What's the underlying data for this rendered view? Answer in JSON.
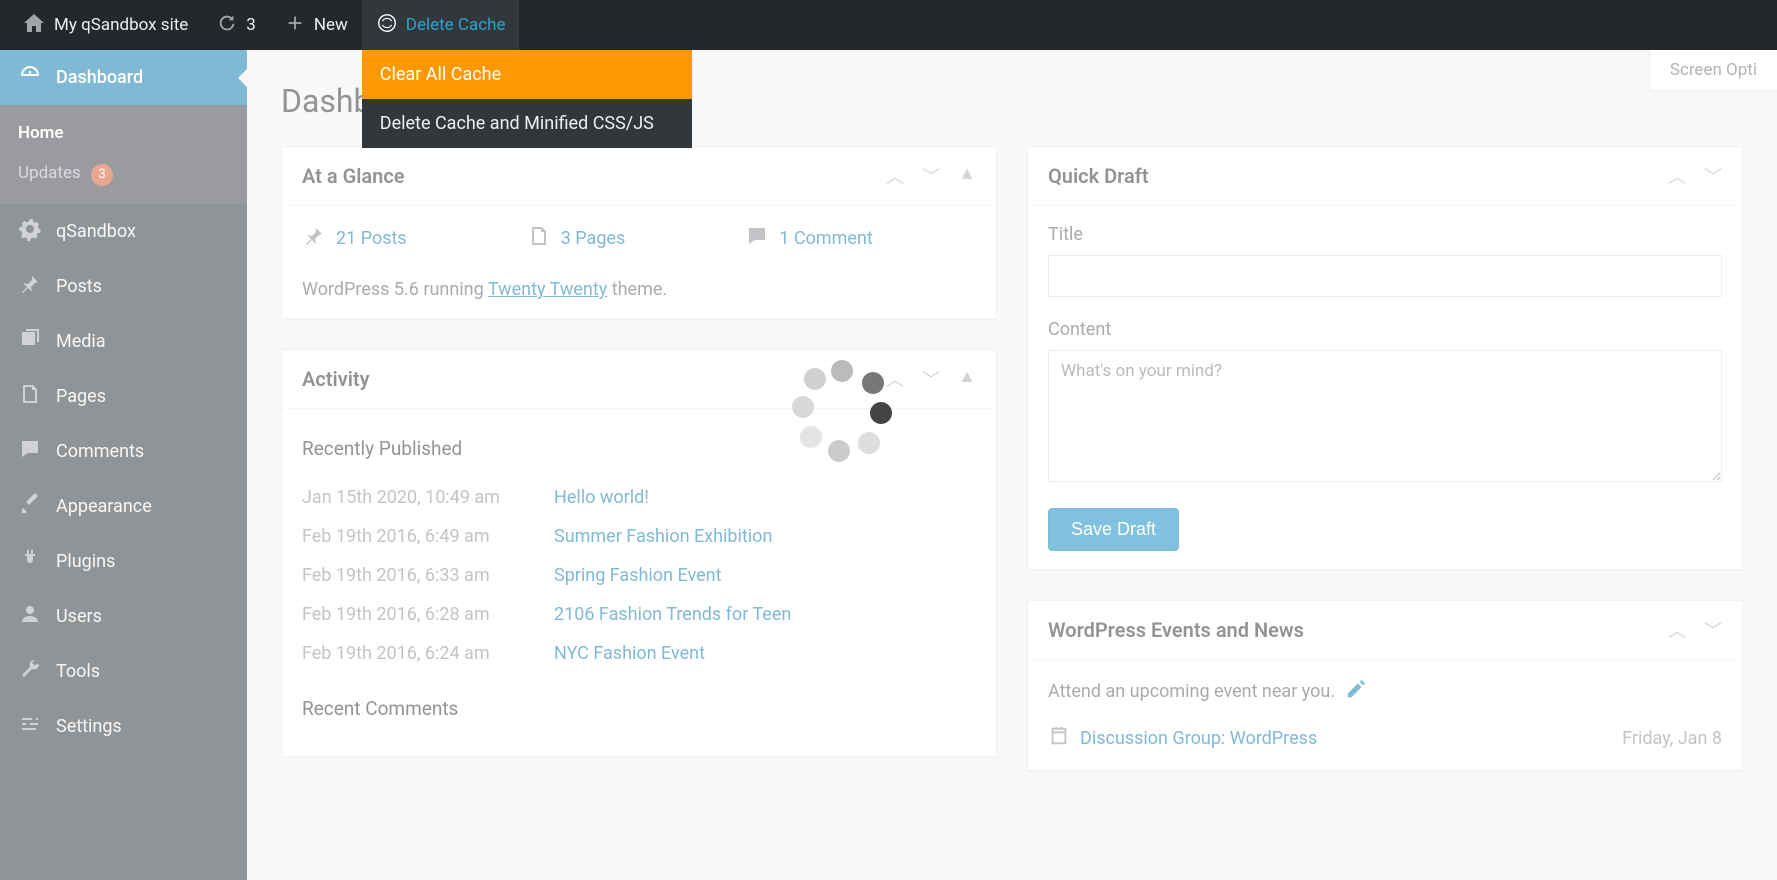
{
  "adminbar": {
    "site_name": "My qSandbox site",
    "refresh_count": "3",
    "new_label": "New",
    "delete_cache_label": "Delete Cache",
    "dropdown": {
      "clear_all": "Clear All Cache",
      "delete_minified": "Delete Cache and Minified CSS/JS"
    }
  },
  "screen_options": "Screen Opti",
  "page_title": "Dashboard",
  "sidebar": {
    "dashboard": "Dashboard",
    "home": "Home",
    "updates": "Updates",
    "updates_count": "3",
    "qsandbox": "qSandbox",
    "posts": "Posts",
    "media": "Media",
    "pages": "Pages",
    "comments": "Comments",
    "appearance": "Appearance",
    "plugins": "Plugins",
    "users": "Users",
    "tools": "Tools",
    "settings": "Settings"
  },
  "glance": {
    "title": "At a Glance",
    "posts": "21 Posts",
    "pages": "3 Pages",
    "comments": "1 Comment",
    "note_pre": "WordPress 5.6 running ",
    "theme": "Twenty Twenty",
    "note_post": " theme."
  },
  "activity": {
    "title": "Activity",
    "recent_pub": "Recently Published",
    "recent_comments": "Recent Comments",
    "rows": [
      {
        "date": "Jan 15th 2020, 10:49 am",
        "title": "Hello world!"
      },
      {
        "date": "Feb 19th 2016, 6:49 am",
        "title": "Summer Fashion Exhibition"
      },
      {
        "date": "Feb 19th 2016, 6:33 am",
        "title": "Spring Fashion Event"
      },
      {
        "date": "Feb 19th 2016, 6:28 am",
        "title": "2106 Fashion Trends for Teen"
      },
      {
        "date": "Feb 19th 2016, 6:24 am",
        "title": "NYC Fashion Event"
      }
    ]
  },
  "quickdraft": {
    "title": "Quick Draft",
    "title_label": "Title",
    "content_label": "Content",
    "content_placeholder": "What's on your mind?",
    "save": "Save Draft"
  },
  "events": {
    "title": "WordPress Events and News",
    "intro": "Attend an upcoming event near you.",
    "row": {
      "name": "Discussion Group: WordPress",
      "date": "Friday, Jan 8"
    }
  }
}
